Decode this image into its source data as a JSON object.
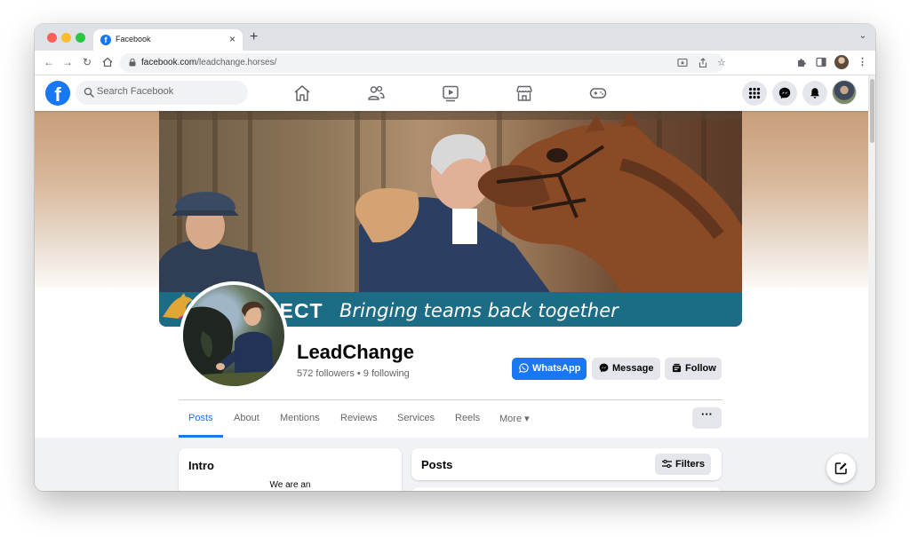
{
  "browser": {
    "tab_title": "Facebook",
    "tab_close": "×",
    "new_tab": "+",
    "tab_menu": "⌄",
    "url_domain": "facebook.com",
    "url_path": "/leadchange.horses/"
  },
  "fb": {
    "logo_letter": "f",
    "search_placeholder": "Search Facebook"
  },
  "cover": {
    "banner_strong": "NECT",
    "banner_text": "Bringing teams back together"
  },
  "profile": {
    "name": "LeadChange",
    "stats": "572 followers • 9 following",
    "buttons": {
      "whatsapp": "WhatsApp",
      "message": "Message",
      "follow": "Follow"
    },
    "more_label": "···"
  },
  "tabs": [
    {
      "label": "Posts"
    },
    {
      "label": "About"
    },
    {
      "label": "Mentions"
    },
    {
      "label": "Reviews"
    },
    {
      "label": "Services"
    },
    {
      "label": "Reels"
    },
    {
      "label": "More ▾"
    }
  ],
  "intro": {
    "title": "Intro",
    "text": "We are an"
  },
  "posts": {
    "title": "Posts",
    "filters_label": "Filters"
  },
  "colors": {
    "fb_blue": "#1877f2",
    "banner_teal": "#1c6c86",
    "page_bg": "#f0f2f5"
  }
}
